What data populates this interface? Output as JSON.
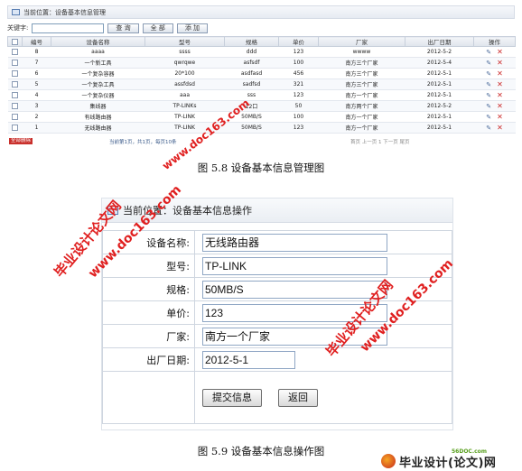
{
  "fig1": {
    "breadcrumb": "当前位置：设备基本信息管理",
    "keyword_label": "关键字:",
    "buttons": {
      "query": "查 询",
      "all": "全 部",
      "add": "添 加"
    },
    "columns": [
      "编号",
      "设备名称",
      "型号",
      "规格",
      "单价",
      "厂家",
      "出厂日期",
      "操作"
    ],
    "rows": [
      {
        "id": "8",
        "name": "aaaa",
        "model": "ssss",
        "spec": "ddd",
        "price": "123",
        "vendor": "wwww",
        "date": "2012-5-2"
      },
      {
        "id": "7",
        "name": "一个新工具",
        "model": "qwrqwe",
        "spec": "asfsdf",
        "price": "100",
        "vendor": "南方三个厂家",
        "date": "2012-5-4"
      },
      {
        "id": "6",
        "name": "一个复杂容器",
        "model": "20*100",
        "spec": "asdfasd",
        "price": "456",
        "vendor": "南方三个厂家",
        "date": "2012-5-1"
      },
      {
        "id": "5",
        "name": "一个复杂工具",
        "model": "assfdsd",
        "spec": "sadfsd",
        "price": "321",
        "vendor": "南方三个厂家",
        "date": "2012-5-1"
      },
      {
        "id": "4",
        "name": "一个复杂仪器",
        "model": "aaa",
        "spec": "sss",
        "price": "123",
        "vendor": "南方一个厂家",
        "date": "2012-5-1"
      },
      {
        "id": "3",
        "name": "集线器",
        "model": "TP-LINKs",
        "spec": "12口",
        "price": "50",
        "vendor": "南方两个厂家",
        "date": "2012-5-2"
      },
      {
        "id": "2",
        "name": "有线路由器",
        "model": "TP-LINK",
        "spec": "50MB/S",
        "price": "100",
        "vendor": "南方一个厂家",
        "date": "2012-5-1"
      },
      {
        "id": "1",
        "name": "无线路由器",
        "model": "TP-LINK",
        "spec": "50MB/S",
        "price": "123",
        "vendor": "南方一个厂家",
        "date": "2012-5-1"
      }
    ],
    "delete_all": "全部删除",
    "pager_info": "当前第1页，共1页，每页10条",
    "pager_nav": "首页 上一页 1 下一页 尾页",
    "caption": "图 5.8  设备基本信息管理图"
  },
  "fig2": {
    "breadcrumb": "当前位置：设备基本信息操作",
    "fields": [
      {
        "label": "设备名称:",
        "value": "无线路由器"
      },
      {
        "label": "型号:",
        "value": "TP-LINK"
      },
      {
        "label": "规格:",
        "value": "50MB/S"
      },
      {
        "label": "单价:",
        "value": "123"
      },
      {
        "label": "厂家:",
        "value": "南方一个厂家"
      },
      {
        "label": "出厂日期:",
        "value": "2012-5-1"
      }
    ],
    "submit": "提交信息",
    "back": "返回",
    "caption": "图 5.9  设备基本信息操作图"
  },
  "watermarks": {
    "site_cn": "毕业设计论文网",
    "site_url": "www.doc163.com",
    "logo_text": "毕业设计(论文)网",
    "logo_domain": "56DOC.com"
  }
}
